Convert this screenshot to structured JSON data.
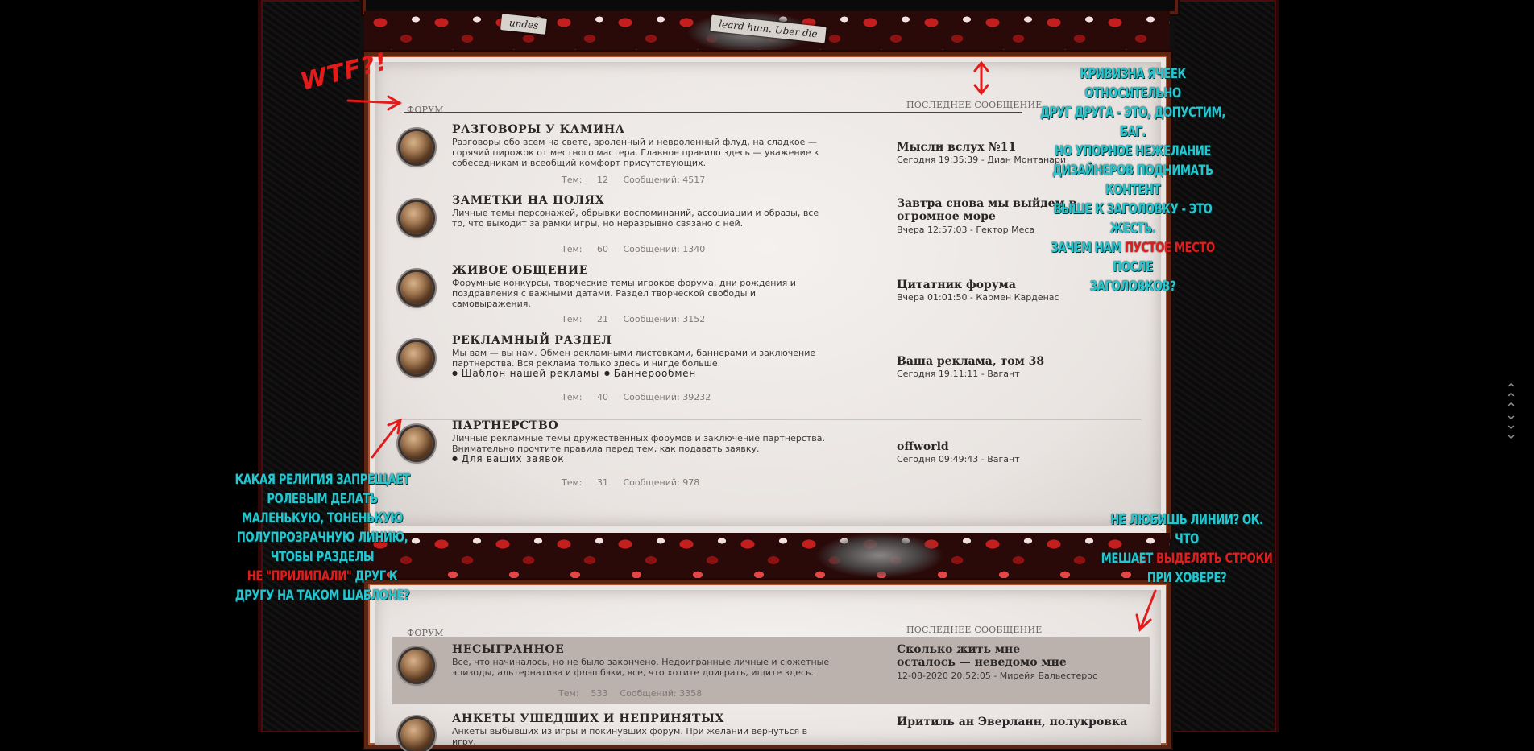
{
  "colors": {
    "annotation": "#22c7cf",
    "annotation_red": "#e01c1c",
    "frame_border": "#5b2513",
    "hover_row": "#bcb2ad"
  },
  "banner": {
    "left_text": "undes",
    "right_text": "leard hum. Uber die"
  },
  "section1": {
    "col_forum": "Форум",
    "col_last": "Последнее сообщение",
    "stats_topics_label": "Тем:",
    "stats_posts_label": "Сообщений:",
    "forums": [
      {
        "title": "РАЗГОВОРЫ У КАМИНА",
        "desc": "Разговоры обо всем на свете, вроленный и невроленный флуд, на сладкое — горячий пирожок от местного мастера. Главное правило здесь — уважение к собеседникам и всеобщий комфорт присутствующих.",
        "sublinks": [],
        "topics": "12",
        "posts": "4517",
        "last_title": "Мысли вслух №11",
        "last_meta": "Сегодня 19:35:39 - Диан Монтанари"
      },
      {
        "title": "ЗАМЕТКИ НА ПОЛЯХ",
        "desc": "Личные темы персонажей, обрывки воспоминаний, ассоциации и образы, все то, что выходит за рамки игры, но неразрывно связано с ней.",
        "sublinks": [],
        "topics": "60",
        "posts": "1340",
        "last_title": "Завтра снова мы выйдем в огромное море",
        "last_meta": "Вчера 12:57:03 - Гектор Меса"
      },
      {
        "title": "ЖИВОЕ ОБЩЕНИЕ",
        "desc": "Форумные конкурсы, творческие темы игроков форума, дни рождения и поздравления с важными датами. Раздел творческой свободы и самовыражения.",
        "sublinks": [],
        "topics": "21",
        "posts": "3152",
        "last_title": "Цитатник форума",
        "last_meta": "Вчера 01:01:50 - Кармен Карденас"
      },
      {
        "title": "РЕКЛАМНЫЙ РАЗДЕЛ",
        "desc": "Мы вам — вы нам. Обмен рекламными листовками, баннерами и заключение партнерства. Вся реклама только здесь и нигде больше.",
        "sublinks": [
          "Шаблон нашей рекламы",
          "Баннерообмен"
        ],
        "topics": "40",
        "posts": "39232",
        "last_title": "Ваша реклама, том 38",
        "last_meta": "Сегодня 19:11:11 - Вагант"
      },
      {
        "title": "ПАРТНЕРСТВО",
        "desc": "Личные рекламные темы дружественных форумов и заключение партнерства. Внимательно прочтите правила перед тем, как подавать заявку.",
        "sublinks": [
          "Для ваших заявок"
        ],
        "topics": "31",
        "posts": "978",
        "last_title": "offworld",
        "last_meta": "Сегодня 09:49:43 - Вагант"
      }
    ]
  },
  "section2": {
    "col_forum": "Форум",
    "col_last": "Последнее сообщение",
    "stats_topics_label": "Тем:",
    "stats_posts_label": "Сообщений:",
    "forums": [
      {
        "title": "НЕСЫГРАННОЕ",
        "desc": "Все, что начиналось, но не было закончено. Недоигранные личные и сюжетные эпизоды, альтернатива и флэшбэки, все, что хотите доиграть, ищите здесь.",
        "topics": "533",
        "posts": "3358",
        "last_title": "Сколько жить мне осталось — неведомо мне",
        "last_meta": "12-08-2020 20:52:05 - Мирейя Бальестерос"
      },
      {
        "title": "АНКЕТЫ УШЕДШИХ И НЕПРИНЯТЫХ",
        "desc": "Анкеты выбывших из игры и покинувших форум. При желании вернуться в игру,",
        "topics": "",
        "posts": "",
        "last_title": "Иритиль ан Эверланн, полукровка",
        "last_meta": ""
      }
    ]
  },
  "annotations": {
    "wtf": "WTF?!",
    "top_right": {
      "l1": "КРИВИЗНА ЯЧЕЕК ОТНОСИТЕЛЬНО",
      "l2": "ДРУГ ДРУГА - ЭТО, ДОПУСТИМ, БАГ.",
      "l3": "НО УПОРНОЕ НЕЖЕЛАНИЕ",
      "l4": "ДИЗАЙНЕРОВ ПОДНИМАТЬ КОНТЕНТ",
      "l5": "ВЫШЕ К ЗАГОЛОВКУ - ЭТО ЖЕСТЬ.",
      "l6a": "ЗАЧЕМ НАМ ",
      "l6b": "ПУСТОЕ МЕСТО",
      "l6c": " ПОСЛЕ",
      "l7": "ЗАГОЛОВКОВ?"
    },
    "left": {
      "l1": "КАКАЯ РЕЛИГИЯ ЗАПРЕЩАЕТ",
      "l2": "РОЛЕВЫМ ДЕЛАТЬ",
      "l3": "МАЛЕНЬКУЮ, ТОНЕНЬКУЮ",
      "l4": "ПОЛУПРОЗРАЧНУЮ ЛИНИЮ,",
      "l5": "ЧТОБЫ РАЗДЕЛЫ",
      "l6a": "НЕ \"ПРИЛИПАЛИ\"",
      "l6b": " ДРУГ К",
      "l7": "ДРУГУ НА ТАКОМ ШАБЛОНЕ?"
    },
    "right": {
      "l1": "НЕ ЛЮБИШЬ ЛИНИИ? ОК. ЧТО",
      "l2a": "МЕШАЕТ ",
      "l2b": "ВЫДЕЛЯТЬ СТРОКИ",
      "l3": "ПРИ ХОВЕРЕ?"
    }
  },
  "scroll_controls": {
    "up": "⌃",
    "down": "⌄"
  }
}
